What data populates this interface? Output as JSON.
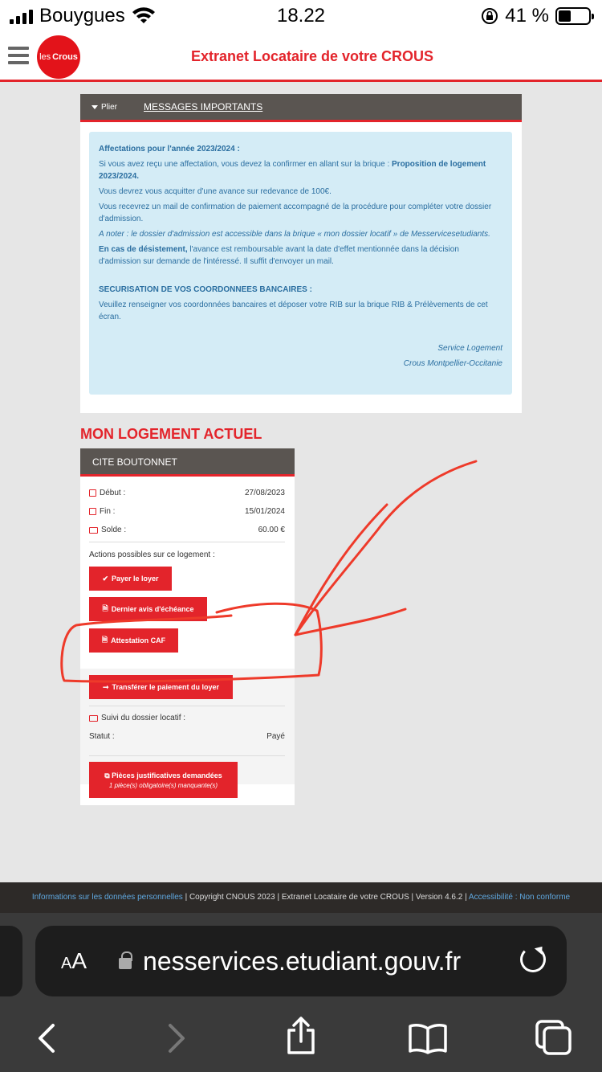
{
  "status": {
    "carrier": "Bouygues",
    "time": "18.22",
    "battery": "41 %",
    "battery_level": 0.41
  },
  "header": {
    "logo_text_1": "les",
    "logo_text_2": "Crous",
    "title": "Extranet Locataire de votre CROUS"
  },
  "messages": {
    "toggle_label": "Plier",
    "title": "MESSAGES IMPORTANTS",
    "p1": "Affectations pour l'année 2023/2024 :",
    "p2a": "Si vous avez reçu une affectation, vous devez la confirmer en allant sur la brique : ",
    "p2b": "Proposition de logement 2023/2024.",
    "p3": "Vous devrez vous acquitter d'une avance sur redevance de 100€.",
    "p4": "Vous recevrez un mail de confirmation de paiement accompagné de la procédure pour compléter votre dossier d'admission.",
    "p5": "A noter : le dossier d'admission est accessible dans la brique « mon dossier locatif » de Messervicesetudiants.",
    "p6a": "En cas de désistement,",
    "p6b": " l'avance est remboursable avant la date d'effet mentionnée dans la décision d'admission sur demande de l'intéressé. Il suffit d'envoyer un mail.",
    "p7": "SECURISATION DE VOS COORDONNEES BANCAIRES :",
    "p8": "Veuillez renseigner vos coordonnées bancaires et déposer votre RIB sur la brique RIB & Prélèvements de cet écran.",
    "sig1": "Service Logement",
    "sig2": "Crous Montpellier-Occitanie"
  },
  "housing": {
    "section_title": "MON LOGEMENT ACTUEL",
    "residence": "CITE BOUTONNET",
    "debut_label": "Début :",
    "debut_value": "27/08/2023",
    "fin_label": "Fin :",
    "fin_value": "15/01/2024",
    "solde_label": "Solde :",
    "solde_value": "60.00 €",
    "actions_label": "Actions possibles sur ce logement :",
    "btn_pay": "Payer le loyer",
    "btn_avis": "Dernier avis d'échéance",
    "btn_caf": "Attestation CAF",
    "btn_transfer": "Transférer le paiement du loyer",
    "suivi_label": "Suivi du dossier locatif :",
    "statut_label": "Statut :",
    "statut_value": "Payé",
    "btn_pieces": "Pièces justificatives demandées",
    "btn_pieces_sub": "1 pièce(s) obligatoire(s) manquante(s)"
  },
  "footer": {
    "link_privacy": "Informations sur les données personnelles",
    "text": " | Copyright CNOUS 2023 | Extranet Locataire de votre CROUS | Version 4.6.2 | ",
    "link_access": "Accessibilité : Non conforme"
  },
  "browser": {
    "aa_small": "A",
    "aa_big": "A",
    "url": "nesservices.etudiant.gouv.fr"
  },
  "colors": {
    "brand_red": "#e3242b",
    "panel_dark": "#5a5551",
    "info_bg": "#d4ecf6",
    "info_text": "#2a6ea0"
  }
}
